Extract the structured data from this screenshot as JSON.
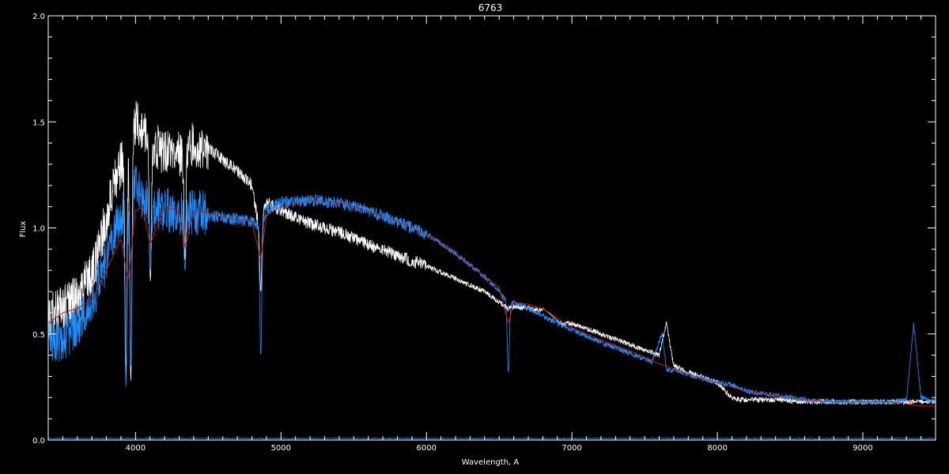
{
  "chart_data": {
    "type": "line",
    "title": "6763",
    "xlabel": "Wavelength, A",
    "ylabel": "Flux",
    "xlim": [
      3400,
      9500
    ],
    "ylim": [
      0.0,
      2.0
    ],
    "x_ticks": [
      4000,
      5000,
      6000,
      7000,
      8000,
      9000
    ],
    "x_tick_labels": [
      "4000",
      "5000",
      "6000",
      "7000",
      "8000",
      "9000"
    ],
    "y_ticks": [
      0.0,
      0.5,
      1.0,
      1.5,
      2.0
    ],
    "y_tick_labels": [
      "0.0",
      "0.5",
      "1.0",
      "1.5",
      "2.0"
    ],
    "grid": false,
    "background": "#000000",
    "series": [
      {
        "color": "#ffffff",
        "x": [
          3400,
          3500,
          3600,
          3700,
          3750,
          3800,
          3850,
          3900,
          3950,
          4000,
          4050,
          4100,
          4150,
          4200,
          4300,
          4400,
          4500,
          4600,
          4700,
          4800,
          4850,
          4900,
          5000,
          5200,
          5400,
          5600,
          5800,
          6000,
          6200,
          6400,
          6560,
          6600,
          6800,
          6900,
          7000,
          7200,
          7400,
          7600,
          7650,
          7700,
          7800,
          8000,
          8100,
          8150,
          8200,
          8400,
          8600,
          8800,
          9000,
          9200,
          9300,
          9400,
          9500
        ],
        "y": [
          0.58,
          0.62,
          0.68,
          0.78,
          0.9,
          1.05,
          1.2,
          1.3,
          1.35,
          1.5,
          1.45,
          1.4,
          1.38,
          1.35,
          1.35,
          1.4,
          1.38,
          1.32,
          1.27,
          1.2,
          1.0,
          1.12,
          1.08,
          1.02,
          0.98,
          0.92,
          0.87,
          0.82,
          0.76,
          0.7,
          0.62,
          0.63,
          0.61,
          0.55,
          0.55,
          0.5,
          0.45,
          0.4,
          0.55,
          0.35,
          0.32,
          0.27,
          0.2,
          0.19,
          0.19,
          0.19,
          0.18,
          0.18,
          0.18,
          0.18,
          0.18,
          0.18,
          0.18
        ],
        "dips": [
          [
            3934,
            0.3
          ],
          [
            3968,
            0.28
          ],
          [
            4102,
            0.75
          ],
          [
            4340,
            0.85
          ],
          [
            4861,
            0.7
          ],
          [
            5890,
            0.82
          ]
        ]
      },
      {
        "color": "#1e8fff",
        "x": [
          3400,
          3500,
          3600,
          3700,
          3750,
          3800,
          3850,
          3900,
          3950,
          4000,
          4050,
          4100,
          4150,
          4200,
          4300,
          4400,
          4500,
          4600,
          4700,
          4800,
          4850,
          4900,
          5000,
          5200,
          5400,
          5600,
          5800,
          6000,
          6200,
          6400,
          6500,
          6560,
          6600,
          6700,
          6900,
          7000,
          7200,
          7400,
          7550,
          7620,
          7650,
          7700,
          7800,
          8000,
          8100,
          8200,
          8400,
          8600,
          8800,
          9000,
          9200,
          9300,
          9350,
          9400,
          9500
        ],
        "y": [
          0.46,
          0.48,
          0.55,
          0.65,
          0.75,
          0.85,
          0.98,
          1.05,
          1.1,
          1.2,
          1.15,
          1.12,
          1.1,
          1.08,
          1.07,
          1.08,
          1.06,
          1.05,
          1.04,
          1.03,
          1.0,
          1.08,
          1.12,
          1.13,
          1.12,
          1.08,
          1.03,
          0.97,
          0.88,
          0.77,
          0.7,
          0.64,
          0.65,
          0.62,
          0.55,
          0.52,
          0.46,
          0.41,
          0.37,
          0.5,
          0.33,
          0.33,
          0.31,
          0.27,
          0.26,
          0.23,
          0.21,
          0.19,
          0.18,
          0.18,
          0.18,
          0.19,
          0.55,
          0.2,
          0.18
        ],
        "dips": [
          [
            3934,
            0.25
          ],
          [
            3968,
            0.35
          ],
          [
            4102,
            0.8
          ],
          [
            4340,
            0.8
          ],
          [
            4861,
            0.4
          ],
          [
            6563,
            0.32
          ]
        ]
      },
      {
        "color": "#cc1a1a",
        "x": [
          3400,
          3500,
          3600,
          3700,
          3800,
          3900,
          3950,
          4000,
          4050,
          4100,
          4200,
          4300,
          4340,
          4400,
          4500,
          4600,
          4700,
          4800,
          4861,
          4900,
          5000,
          5200,
          5400,
          5600,
          5800,
          6000,
          6200,
          6400,
          6500,
          6563,
          6600,
          6700,
          6800,
          7000,
          7200,
          7400,
          7600,
          7800,
          8000,
          8200,
          8400,
          8600,
          8800,
          9000,
          9200,
          9300,
          9400,
          9500
        ],
        "y": [
          0.55,
          0.6,
          0.62,
          0.66,
          0.8,
          0.95,
          0.75,
          1.08,
          1.1,
          0.92,
          1.1,
          1.08,
          0.9,
          1.08,
          1.07,
          1.05,
          1.04,
          1.03,
          0.85,
          1.06,
          1.1,
          1.13,
          1.12,
          1.08,
          1.03,
          0.97,
          0.88,
          0.77,
          0.72,
          0.55,
          0.65,
          0.64,
          0.62,
          0.53,
          0.47,
          0.42,
          0.36,
          0.31,
          0.27,
          0.23,
          0.21,
          0.19,
          0.18,
          0.18,
          0.18,
          0.17,
          0.16,
          0.16
        ]
      }
    ]
  }
}
